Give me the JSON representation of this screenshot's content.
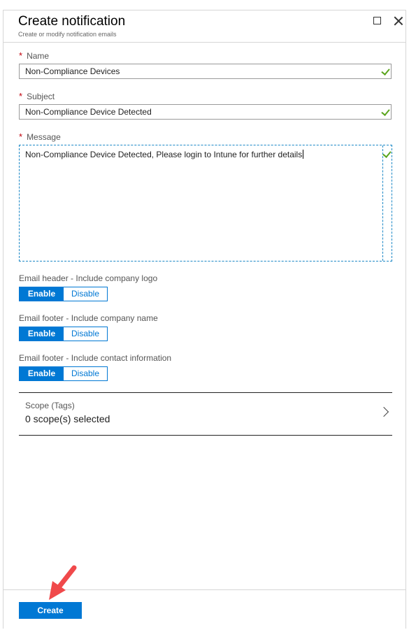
{
  "header": {
    "title": "Create notification",
    "subtitle": "Create or modify notification emails"
  },
  "form": {
    "required_marker": "*",
    "name": {
      "label": "Name",
      "value": "Non-Compliance Devices"
    },
    "subject": {
      "label": "Subject",
      "value": "Non-Compliance Device Detected"
    },
    "message": {
      "label": "Message",
      "value": "Non-Compliance Device Detected, Please login to Intune for further details"
    }
  },
  "toggles": [
    {
      "label": "Email header - Include company logo",
      "on_label": "Enable",
      "off_label": "Disable",
      "selected": "Enable"
    },
    {
      "label": "Email footer - Include company name",
      "on_label": "Enable",
      "off_label": "Disable",
      "selected": "Enable"
    },
    {
      "label": "Email footer - Include contact information",
      "on_label": "Enable",
      "off_label": "Disable",
      "selected": "Enable"
    }
  ],
  "scope": {
    "label": "Scope (Tags)",
    "value": "0 scope(s) selected"
  },
  "footer": {
    "create_label": "Create"
  },
  "colors": {
    "accent": "#0078d4",
    "valid_check": "#5ba51d",
    "required": "#c0000b",
    "annotation_arrow": "#f0494b"
  }
}
